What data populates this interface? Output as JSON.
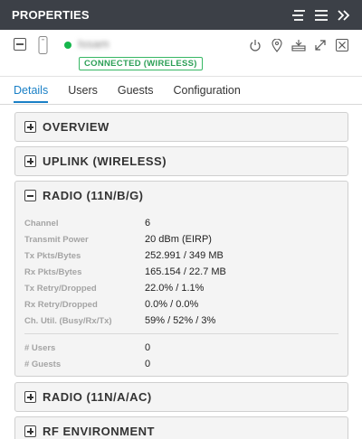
{
  "header": {
    "title": "PROPERTIES",
    "tool_icons": [
      "align-icon",
      "menu-icon",
      "double-chevron-right-icon"
    ]
  },
  "device": {
    "name": "Issam",
    "status_badge": "CONNECTED (WIRELESS)",
    "status_color": "#15b64c",
    "action_icons": [
      "power-icon",
      "locate-icon",
      "network-icon",
      "expand-icon",
      "close-box-icon"
    ]
  },
  "tabs": [
    {
      "label": "Details",
      "active": true
    },
    {
      "label": "Users",
      "active": false
    },
    {
      "label": "Guests",
      "active": false
    },
    {
      "label": "Configuration",
      "active": false
    }
  ],
  "sections": {
    "overview": {
      "title": "OVERVIEW",
      "expanded": false
    },
    "uplink": {
      "title": "UPLINK (WIRELESS)",
      "expanded": false
    },
    "radio_bgn": {
      "title": "RADIO (11N/B/G)",
      "expanded": true,
      "stats": [
        {
          "label": "Channel",
          "value": "6"
        },
        {
          "label": "Transmit Power",
          "value": "20 dBm (EIRP)"
        },
        {
          "label": "Tx Pkts/Bytes",
          "value": "252.991 / 349 MB"
        },
        {
          "label": "Rx Pkts/Bytes",
          "value": "165.154 / 22.7 MB"
        },
        {
          "label": "Tx Retry/Dropped",
          "value": "22.0% / 1.1%"
        },
        {
          "label": "Rx Retry/Dropped",
          "value": "0.0% / 0.0%"
        },
        {
          "label": "Ch. Util. (Busy/Rx/Tx)",
          "value": "59% / 52% / 3%"
        }
      ],
      "counts": [
        {
          "label": "# Users",
          "value": "0"
        },
        {
          "label": "# Guests",
          "value": "0"
        }
      ]
    },
    "radio_ac": {
      "title": "RADIO (11N/A/AC)",
      "expanded": false
    },
    "rf_env": {
      "title": "RF ENVIRONMENT",
      "expanded": false
    }
  },
  "colors": {
    "accent": "#1a80c6",
    "titlebar": "#3c4047",
    "badge": "#37b764"
  }
}
